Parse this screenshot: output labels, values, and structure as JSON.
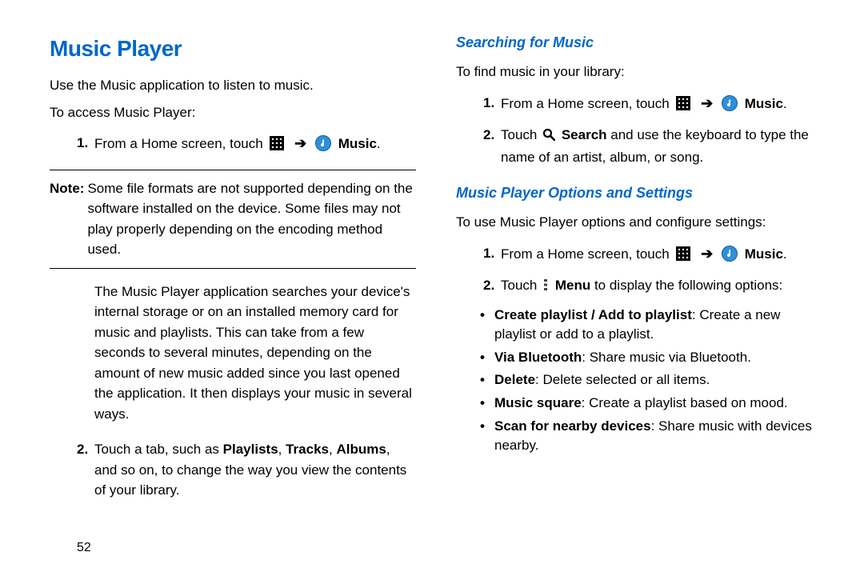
{
  "left": {
    "title": "Music Player",
    "intro1": "Use the Music application to listen to music.",
    "intro2": "To access Music Player:",
    "step1_num": "1.",
    "step1_a": "From a Home screen, touch ",
    "step1_music": "Music",
    "period": ".",
    "note_label": "Note:",
    "note_body": "Some file formats are not supported depending on the software installed on the device. Some files may not play properly depending on the encoding method used.",
    "para_search": "The Music Player application searches your device's internal storage or on an installed memory card for music and playlists. This can take from a few seconds to several minutes, depending on the amount of new music added since you last opened the application. It then displays your music in several ways.",
    "step2_num": "2.",
    "step2_a": "Touch a tab, such as ",
    "step2_b": "Playlists",
    "step2_c": ", ",
    "step2_d": "Tracks",
    "step2_e": ", ",
    "step2_f": "Albums",
    "step2_g": ", and so on, to change the way you view the contents of your library."
  },
  "right": {
    "h_search": "Searching for Music",
    "search_intro": "To find music in your library:",
    "s1_num": "1.",
    "s1_a": "From a Home screen, touch ",
    "s1_music": "Music",
    "s2_num": "2.",
    "s2_a": "Touch ",
    "s2_search": "Search",
    "s2_b": " and use the keyboard to type the name of an artist, album, or song.",
    "h_options": "Music Player Options and Settings",
    "opt_intro": "To use Music Player options and configure settings:",
    "o1_num": "1.",
    "o1_a": "From a Home screen, touch ",
    "o1_music": "Music",
    "o2_num": "2.",
    "o2_a": "Touch ",
    "o2_menu": "Menu",
    "o2_b": " to display the following options:",
    "b1_bold": "Create playlist / Add to playlist",
    "b1_rest": ": Create a new playlist or add to a playlist.",
    "b2_bold": "Via Bluetooth",
    "b2_rest": ": Share music via Bluetooth.",
    "b3_bold": "Delete",
    "b3_rest": ": Delete selected or all items.",
    "b4_bold": "Music square",
    "b4_rest": ": Create a playlist based on mood.",
    "b5_bold": "Scan for nearby devices",
    "b5_rest": ": Share music with devices nearby."
  },
  "page_number": "52"
}
